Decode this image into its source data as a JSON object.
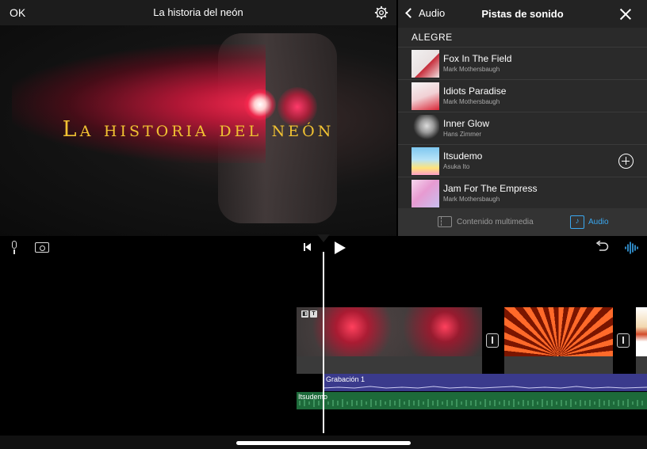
{
  "viewer": {
    "ok_label": "OK",
    "project_title": "La historia del neón",
    "overlay_title": "La historia del neón"
  },
  "panel": {
    "back_label": "Audio",
    "title": "Pistas de sonido",
    "section": "ALEGRE",
    "tracks": [
      {
        "title": "Fox In The Field",
        "artist": "Mark Mothersbaugh",
        "art": "album-art"
      },
      {
        "title": "Idiots Paradise",
        "artist": "Mark Mothersbaugh",
        "art": "album-art"
      },
      {
        "title": "Inner Glow",
        "artist": "Hans Zimmer",
        "art": "album-art"
      },
      {
        "title": "Itsudemo",
        "artist": "Asuka Ito",
        "art": "album-art",
        "add_icon": "plus-circle-icon"
      },
      {
        "title": "Jam For The Empress",
        "artist": "Mark Mothersbaugh",
        "art": "album-art"
      }
    ],
    "tabs": [
      {
        "label": "Contenido multimedia",
        "icon": "film-icon",
        "active": false
      },
      {
        "label": "Audio",
        "icon": "music-note-icon",
        "active": true
      }
    ]
  },
  "toolbar": {
    "icons": [
      "microphone-icon",
      "camera-icon",
      "skip-back-icon",
      "play-icon",
      "undo-icon",
      "waveform-icon"
    ]
  },
  "timeline": {
    "recording_label": "Grabación 1",
    "music_label": "Itsudemo"
  },
  "colors": {
    "accent": "#3aa8f0",
    "overlay_title": "#f1c232",
    "recording_track": "#3a3a8c",
    "music_track": "#1d6a3a"
  }
}
